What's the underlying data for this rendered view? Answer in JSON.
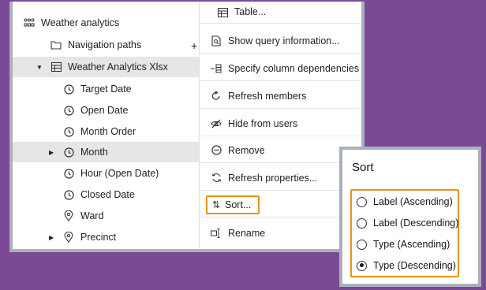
{
  "tree": {
    "root_label": "Weather analytics",
    "items": [
      {
        "label": "Navigation paths",
        "icon": "folder-icon"
      },
      {
        "label": "Weather Analytics Xlsx",
        "icon": "table-icon"
      },
      {
        "label": "Target Date",
        "icon": "clock-icon"
      },
      {
        "label": "Open Date",
        "icon": "clock-icon"
      },
      {
        "label": "Month Order",
        "icon": "clock-icon"
      },
      {
        "label": "Month",
        "icon": "clock-icon"
      },
      {
        "label": "Hour (Open Date)",
        "icon": "clock-icon"
      },
      {
        "label": "Closed Date",
        "icon": "clock-icon"
      },
      {
        "label": "Ward",
        "icon": "location-pin-icon"
      },
      {
        "label": "Precinct",
        "icon": "location-pin-icon"
      }
    ],
    "plus_label": "+"
  },
  "menu": {
    "items": [
      {
        "label": "Table...",
        "icon": "table-icon"
      },
      {
        "label": "Show query information...",
        "icon": "document-icon"
      },
      {
        "label": "Specify column dependencies",
        "icon": "column-dependency-icon"
      },
      {
        "label": "Refresh members",
        "icon": "refresh-icon"
      },
      {
        "label": "Hide from users",
        "icon": "view-off-icon"
      },
      {
        "label": "Remove",
        "icon": "minus-circle-icon"
      },
      {
        "label": "Refresh properties...",
        "icon": "refresh-properties-icon"
      },
      {
        "label": "Sort...",
        "icon": "sort-icon"
      },
      {
        "label": "Rename",
        "icon": "rename-icon"
      }
    ]
  },
  "sort_panel": {
    "title": "Sort",
    "options": [
      {
        "label": "Label (Ascending)",
        "checked": false
      },
      {
        "label": "Label (Descending)",
        "checked": false
      },
      {
        "label": "Type (Ascending)",
        "checked": false
      },
      {
        "label": "Type (Descending)",
        "checked": true
      }
    ]
  },
  "colors": {
    "background": "#7b4a96",
    "highlight": "#e8931e",
    "selected_row": "#e6e6e6"
  }
}
